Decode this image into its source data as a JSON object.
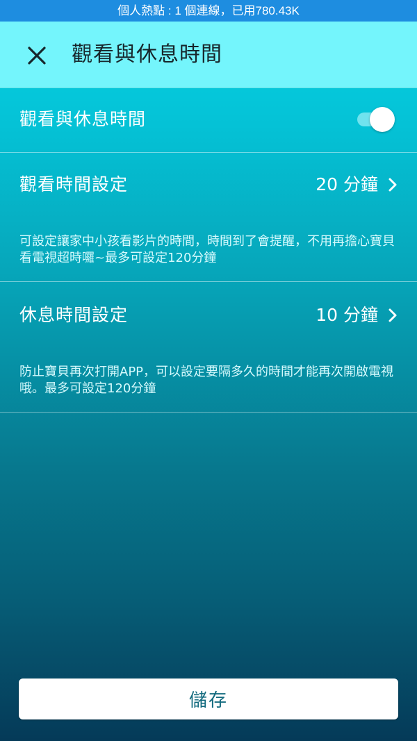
{
  "status_bar": {
    "text": "個人熱點 : 1 個連線，已用780.43K",
    "color": "#1E8DE0"
  },
  "app_bar": {
    "close_icon": "close-icon",
    "title": "觀看與休息時間",
    "color": "#74F5FC"
  },
  "settings": {
    "toggle_row": {
      "label": "觀看與休息時間",
      "enabled": true
    },
    "watch_time": {
      "label": "觀看時間設定",
      "value": "20 分鐘",
      "icon": "chevron-right-icon",
      "description": "可設定讓家中小孩看影片的時間，時間到了會提醒，不用再擔心寶貝看電視超時囉~最多可設定120分鐘"
    },
    "rest_time": {
      "label": "休息時間設定",
      "value": "10 分鐘",
      "icon": "chevron-right-icon",
      "description": "防止寶貝再次打開APP，可以設定要隔多久的時間才能再次開啟電視哦。最多可設定120分鐘"
    }
  },
  "footer": {
    "save_label": "儲存"
  }
}
